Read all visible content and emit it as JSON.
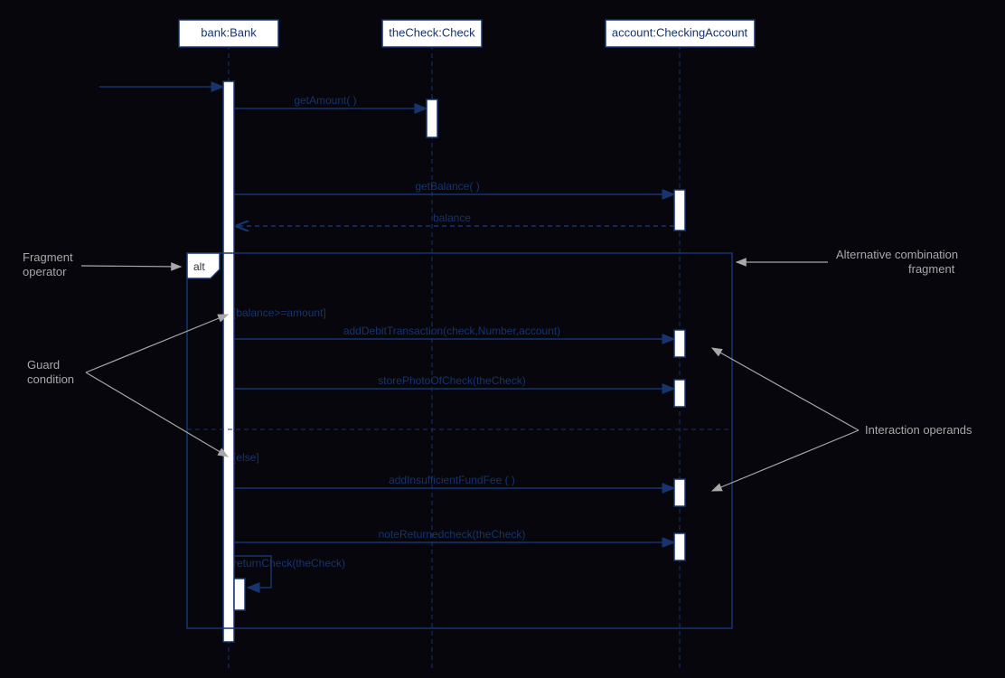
{
  "lifelines": {
    "bank": "bank:Bank",
    "check": "theCheck:Check",
    "account": "account:CheckingAccount"
  },
  "messages": {
    "getAmount": "getAmount( )",
    "getBalance": "getBalance( )",
    "balance": "balance",
    "addDebit": "addDebitTransaction(check,Number,account)",
    "storePhoto": "storePhotoOfCheck(theCheck)",
    "addFee": "addInsufficientFundFee ( )",
    "noteReturned": "noteReturnedcheck(theCheck)",
    "returnCheck": "returnCheck(theCheck)"
  },
  "alt": {
    "label": "alt",
    "guard1": "[balance>=amount]",
    "guard2": "[else]"
  },
  "annotations": {
    "fragOp1": "Fragment",
    "fragOp2": "operator",
    "guardCond1": "Guard",
    "guardCond2": "condition",
    "altFrag1": "Alternative combination",
    "altFrag2": "fragment",
    "interOp": "Interaction operands"
  }
}
